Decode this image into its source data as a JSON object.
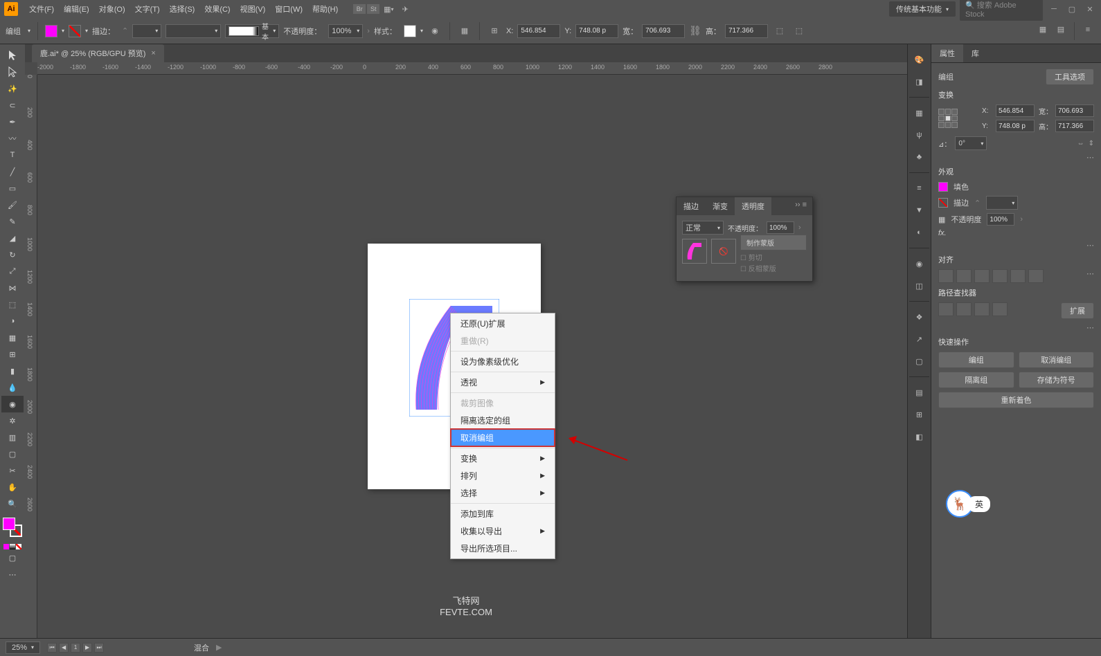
{
  "menubar": {
    "logo": "Ai",
    "items": [
      "文件(F)",
      "编辑(E)",
      "对象(O)",
      "文字(T)",
      "选择(S)",
      "效果(C)",
      "视图(V)",
      "窗口(W)",
      "帮助(H)"
    ],
    "right_icons": [
      "Br",
      "St",
      "⊞",
      "☁"
    ],
    "workspace": "传统基本功能",
    "search_placeholder": "搜索 Adobe Stock"
  },
  "optionsbar": {
    "mode": "编组",
    "stroke_label": "描边：",
    "profile_label": "基本",
    "opacity_label": "不透明度：",
    "opacity_value": "100%",
    "style_label": "样式：",
    "x_label": "X:",
    "x_value": "546.854",
    "y_label": "Y:",
    "y_value": "748.08 p",
    "w_label": "宽：",
    "w_value": "706.693",
    "h_label": "高：",
    "h_value": "717.366"
  },
  "doc": {
    "tab_title": "鹿.ai* @ 25% (RGB/GPU 预览)"
  },
  "ruler_h": [
    "-2000",
    "-1800",
    "-1600",
    "-1400",
    "-1200",
    "-1000",
    "-800",
    "-600",
    "-400",
    "-200",
    "0",
    "200",
    "400",
    "600",
    "800",
    "1000",
    "1200",
    "1400",
    "1600",
    "1800",
    "2000",
    "2200",
    "2400",
    "2600",
    "2800"
  ],
  "ruler_v": [
    "0",
    "200",
    "400",
    "600",
    "800",
    "1000",
    "1200",
    "1400",
    "1600",
    "1800",
    "2000",
    "2200",
    "2400",
    "2600"
  ],
  "context_menu": {
    "items": [
      {
        "label": "还原(U)扩展",
        "type": "item"
      },
      {
        "label": "重做(R)",
        "type": "disabled"
      },
      {
        "type": "sep"
      },
      {
        "label": "设为像素级优化",
        "type": "item"
      },
      {
        "type": "sep"
      },
      {
        "label": "透视",
        "type": "sub"
      },
      {
        "type": "sep"
      },
      {
        "label": "裁剪图像",
        "type": "disabled"
      },
      {
        "label": "隔离选定的组",
        "type": "item"
      },
      {
        "label": "取消编组",
        "type": "hot"
      },
      {
        "type": "sep"
      },
      {
        "label": "变换",
        "type": "sub"
      },
      {
        "label": "排列",
        "type": "sub"
      },
      {
        "label": "选择",
        "type": "sub"
      },
      {
        "type": "sep"
      },
      {
        "label": "添加到库",
        "type": "item"
      },
      {
        "label": "收集以导出",
        "type": "sub"
      },
      {
        "label": "导出所选项目...",
        "type": "item"
      }
    ]
  },
  "transparency_panel": {
    "tabs": [
      "描边",
      "渐变",
      "透明度"
    ],
    "active_tab": 2,
    "blend_mode": "正常",
    "opacity_label": "不透明度：",
    "opacity_value": "100%",
    "make_mask": "制作蒙版",
    "clip": "剪切",
    "invert": "反相蒙版"
  },
  "properties": {
    "tabs": [
      "属性",
      "库"
    ],
    "selection_type": "编组",
    "tool_options_btn": "工具选项",
    "transform_title": "变换",
    "x_label": "X:",
    "x_value": "546.854",
    "y_label": "Y:",
    "y_value": "748.08 p",
    "w_label": "宽：",
    "w_value": "706.693",
    "h_label": "高：",
    "h_value": "717.366",
    "rot_label": "⊿：",
    "rot_value": "0°",
    "appearance_title": "外观",
    "fill_label": "填色",
    "stroke_label": "描边",
    "op_label": "不透明度",
    "op_value": "100%",
    "fx_label": "fx.",
    "align_title": "对齐",
    "pathfinder_title": "路径查找器",
    "pathfinder_more": "扩展",
    "quick_title": "快速操作",
    "btn_group": "编组",
    "btn_ungroup": "取消编组",
    "btn_isolate": "隔离组",
    "btn_symbol": "存储为符号",
    "btn_recolor": "重新着色"
  },
  "statusbar": {
    "zoom": "25%",
    "blend": "混合",
    "watermark_top": "飞特网",
    "watermark_bottom": "FEVTE.COM"
  },
  "ime": {
    "char": "英"
  }
}
